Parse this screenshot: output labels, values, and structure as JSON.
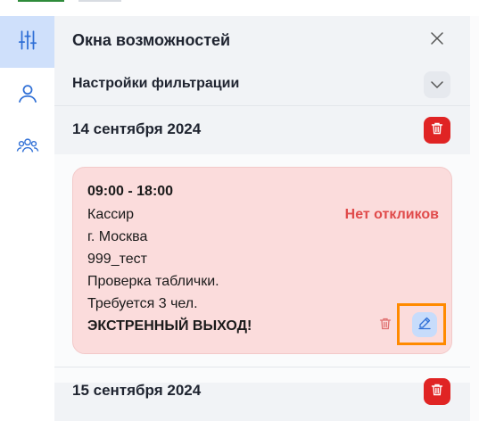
{
  "panel": {
    "title": "Окна возможностей",
    "filter_label": "Настройки фильтрации"
  },
  "dates": [
    {
      "label": "14 сентября 2024"
    },
    {
      "label": "15 сентября 2024"
    }
  ],
  "card": {
    "time": "09:00 - 18:00",
    "role": "Кассир",
    "city": "г. Москва",
    "store": "999_тест",
    "note": "Проверка таблички.",
    "required": "Требуется 3 чел.",
    "urgent": "ЭКСТРЕННЫЙ ВЫХОД!",
    "status": "Нет откликов"
  },
  "colors": {
    "accent": "#2f6fd6",
    "danger": "#e02424",
    "card_bg": "#fbdcdc",
    "status_text": "#e04b4b",
    "highlight": "#ff8a00"
  },
  "icons": {
    "rail": [
      "sliders-icon",
      "user-icon",
      "users-icon"
    ],
    "close": "close-icon",
    "filter_toggle": "chevron-down-icon",
    "delete": "trash-icon",
    "edit": "pencil-icon"
  }
}
